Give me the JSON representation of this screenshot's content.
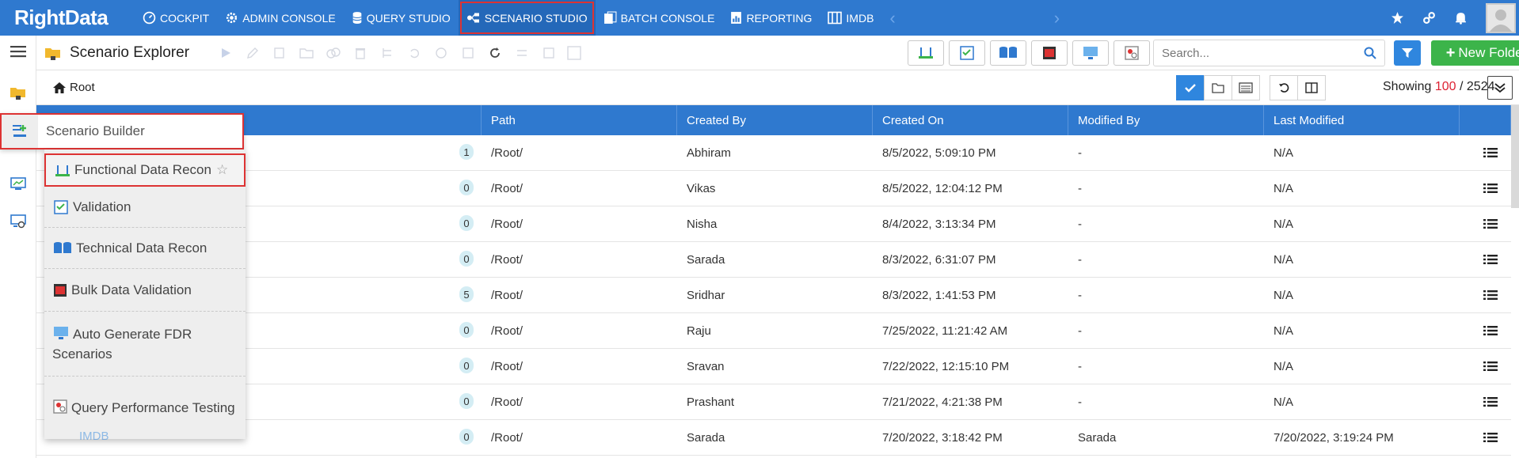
{
  "brand": {
    "name": "RightData"
  },
  "topnav": {
    "items": [
      {
        "label": "COCKPIT",
        "icon": "cockpit-icon"
      },
      {
        "label": "ADMIN CONSOLE",
        "icon": "gear-icon"
      },
      {
        "label": "QUERY STUDIO",
        "icon": "database-icon"
      },
      {
        "label": "SCENARIO STUDIO",
        "icon": "scenario-icon",
        "active": true
      },
      {
        "label": "BATCH CONSOLE",
        "icon": "batch-icon"
      },
      {
        "label": "REPORTING",
        "icon": "chart-icon"
      },
      {
        "label": "IMDB",
        "icon": "imdb-icon"
      }
    ],
    "right_icons": [
      "star-icon",
      "link-icon",
      "bell-icon",
      "avatar"
    ]
  },
  "toolbar": {
    "title": "Scenario Explorer",
    "search_placeholder": "Search...",
    "new_folder_label": "New Folder"
  },
  "breadcrumb": {
    "root": "Root"
  },
  "showing": {
    "prefix": "Showing",
    "count": "100",
    "separator": "/",
    "total": "2524"
  },
  "table": {
    "columns": [
      "",
      "Path",
      "Created By",
      "Created On",
      "Modified By",
      "Last Modified",
      ""
    ],
    "rows": [
      {
        "count": "1",
        "path": "/Root/",
        "created_by": "Abhiram",
        "created_on": "8/5/2022, 5:09:10 PM",
        "modified_by": "-",
        "last_modified": "N/A"
      },
      {
        "count": "0",
        "path": "/Root/",
        "created_by": "Vikas",
        "created_on": "8/5/2022, 12:04:12 PM",
        "modified_by": "-",
        "last_modified": "N/A"
      },
      {
        "count": "0",
        "path": "/Root/",
        "created_by": "Nisha",
        "created_on": "8/4/2022, 3:13:34 PM",
        "modified_by": "-",
        "last_modified": "N/A"
      },
      {
        "count": "0",
        "path": "/Root/",
        "created_by": "Sarada",
        "created_on": "8/3/2022, 6:31:07 PM",
        "modified_by": "-",
        "last_modified": "N/A"
      },
      {
        "count": "5",
        "path": "/Root/",
        "created_by": "Sridhar",
        "created_on": "8/3/2022, 1:41:53 PM",
        "modified_by": "-",
        "last_modified": "N/A"
      },
      {
        "count": "0",
        "path": "/Root/",
        "created_by": "Raju",
        "created_on": "7/25/2022, 11:21:42 AM",
        "modified_by": "-",
        "last_modified": "N/A"
      },
      {
        "count": "0",
        "path": "/Root/",
        "created_by": "Sravan",
        "created_on": "7/22/2022, 12:15:10 PM",
        "modified_by": "-",
        "last_modified": "N/A"
      },
      {
        "count": "0",
        "path": "/Root/",
        "created_by": "Prashant",
        "created_on": "7/21/2022, 4:21:38 PM",
        "modified_by": "-",
        "last_modified": "N/A"
      },
      {
        "count": "0",
        "path": "/Root/",
        "created_by": "Sarada",
        "created_on": "7/20/2022, 3:18:42 PM",
        "modified_by": "Sarada",
        "last_modified": "7/20/2022, 3:19:24 PM"
      }
    ],
    "partial_name": "IMDB"
  },
  "builder": {
    "title": "Scenario Builder",
    "items": [
      {
        "label": "Functional Data Recon",
        "icon": "fdr-icon"
      },
      {
        "label": "Validation",
        "icon": "validation-icon"
      },
      {
        "label": "Technical Data Recon",
        "icon": "tdr-icon"
      },
      {
        "label": "Bulk Data Validation",
        "icon": "bulk-icon"
      },
      {
        "label": "Auto Generate FDR Scenarios",
        "icon": "auto-fdr-icon"
      },
      {
        "label": "Query Performance Testing",
        "icon": "query-perf-icon"
      }
    ]
  }
}
